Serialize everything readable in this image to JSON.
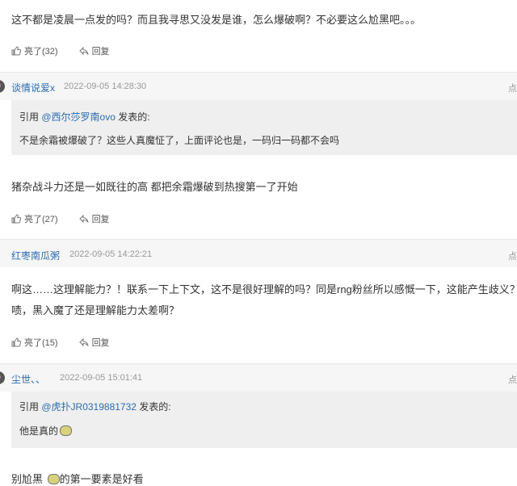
{
  "top_comment": {
    "text": "这不都是凌晨一点发的吗？而且我寻思又没发是谁，怎么爆破啊？不必要这么尬黑吧。。。",
    "like_label": "亮了(32)",
    "reply_label": "回复"
  },
  "comments": [
    {
      "username": "谈情说爱x",
      "time": "2022-09-05 14:28:30",
      "floor": "点",
      "quote_prefix": "引用",
      "quote_user": "@西尔莎罗南ovo",
      "quote_suffix": "发表的:",
      "quote_text": "不是余霜被爆破了？这些人真魔怔了，上面评论也是，一码归一码都不会吗",
      "body": "猪杂战斗力还是一如既往的高  都把余霜爆破到热搜第一了开始",
      "like_label": "亮了(27)",
      "reply_label": "回复"
    },
    {
      "username": "红枣南瓜粥",
      "time": "2022-09-05 14:22:21",
      "floor": "点",
      "body_line1": "啊这……这理解能力？！联系一下上下文，这不是很好理解的吗？同是rng粉丝所以感慨一下，这能产生歧义？",
      "body_line2": "啧，黑入魔了还是理解能力太差啊？",
      "like_label": "亮了(15)",
      "reply_label": "回复"
    },
    {
      "username": "尘世、、",
      "time": "2022-09-05 15:01:41",
      "floor": "点",
      "quote_prefix": "引用",
      "quote_user": "@虎扑JR0319881732",
      "quote_suffix": "发表的:",
      "quote_text": "他是真的",
      "body_pre": "别尬黑",
      "body_post": "的第一要素是好看"
    }
  ],
  "colors": {
    "link": "#2b6cb0",
    "header_bg": "#f6f6f6",
    "quote_bg": "#efefef"
  },
  "icons": [
    "thumb-up-icon",
    "reply-icon",
    "emoji-icon"
  ]
}
